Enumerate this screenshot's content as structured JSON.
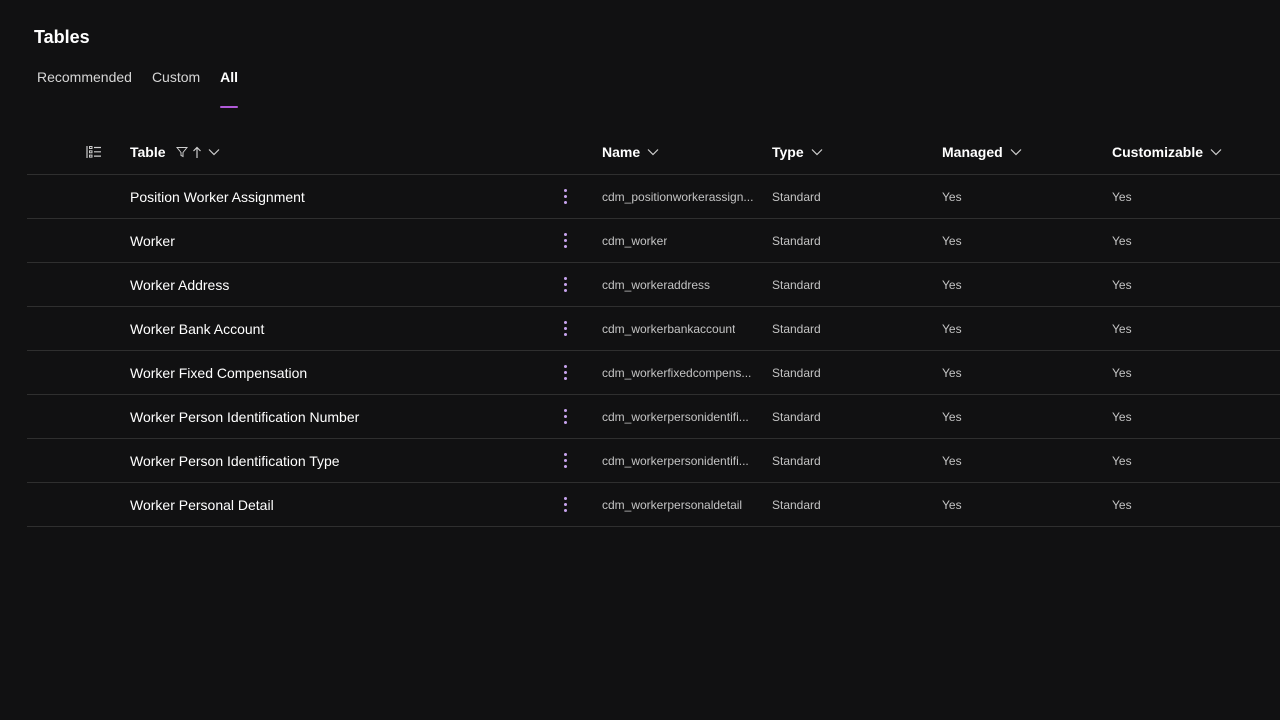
{
  "page": {
    "title": "Tables"
  },
  "colors": {
    "accent": "#b05ad8",
    "dots": "#c8a4ee"
  },
  "tabs": [
    {
      "label": "Recommended",
      "active": false
    },
    {
      "label": "Custom",
      "active": false
    },
    {
      "label": "All",
      "active": true
    }
  ],
  "grid": {
    "icons": {
      "select_all": "list-select-icon",
      "filter": "filter-icon",
      "sort": "sort-ascending-icon",
      "menu": "chevron-down-icon",
      "row_more": "more-vertical-icon"
    },
    "headers": {
      "table": "Table",
      "name": "Name",
      "type": "Type",
      "managed": "Managed",
      "customizable": "Customizable"
    },
    "rows": [
      {
        "table": "Position Worker Assignment",
        "name": "cdm_positionworkerassign...",
        "type": "Standard",
        "managed": "Yes",
        "customizable": "Yes"
      },
      {
        "table": "Worker",
        "name": "cdm_worker",
        "type": "Standard",
        "managed": "Yes",
        "customizable": "Yes"
      },
      {
        "table": "Worker Address",
        "name": "cdm_workeraddress",
        "type": "Standard",
        "managed": "Yes",
        "customizable": "Yes"
      },
      {
        "table": "Worker Bank Account",
        "name": "cdm_workerbankaccount",
        "type": "Standard",
        "managed": "Yes",
        "customizable": "Yes"
      },
      {
        "table": "Worker Fixed Compensation",
        "name": "cdm_workerfixedcompens...",
        "type": "Standard",
        "managed": "Yes",
        "customizable": "Yes"
      },
      {
        "table": "Worker Person Identification Number",
        "name": "cdm_workerpersonidentifi...",
        "type": "Standard",
        "managed": "Yes",
        "customizable": "Yes"
      },
      {
        "table": "Worker Person Identification Type",
        "name": "cdm_workerpersonidentifi...",
        "type": "Standard",
        "managed": "Yes",
        "customizable": "Yes"
      },
      {
        "table": "Worker Personal Detail",
        "name": "cdm_workerpersonaldetail",
        "type": "Standard",
        "managed": "Yes",
        "customizable": "Yes"
      }
    ]
  }
}
